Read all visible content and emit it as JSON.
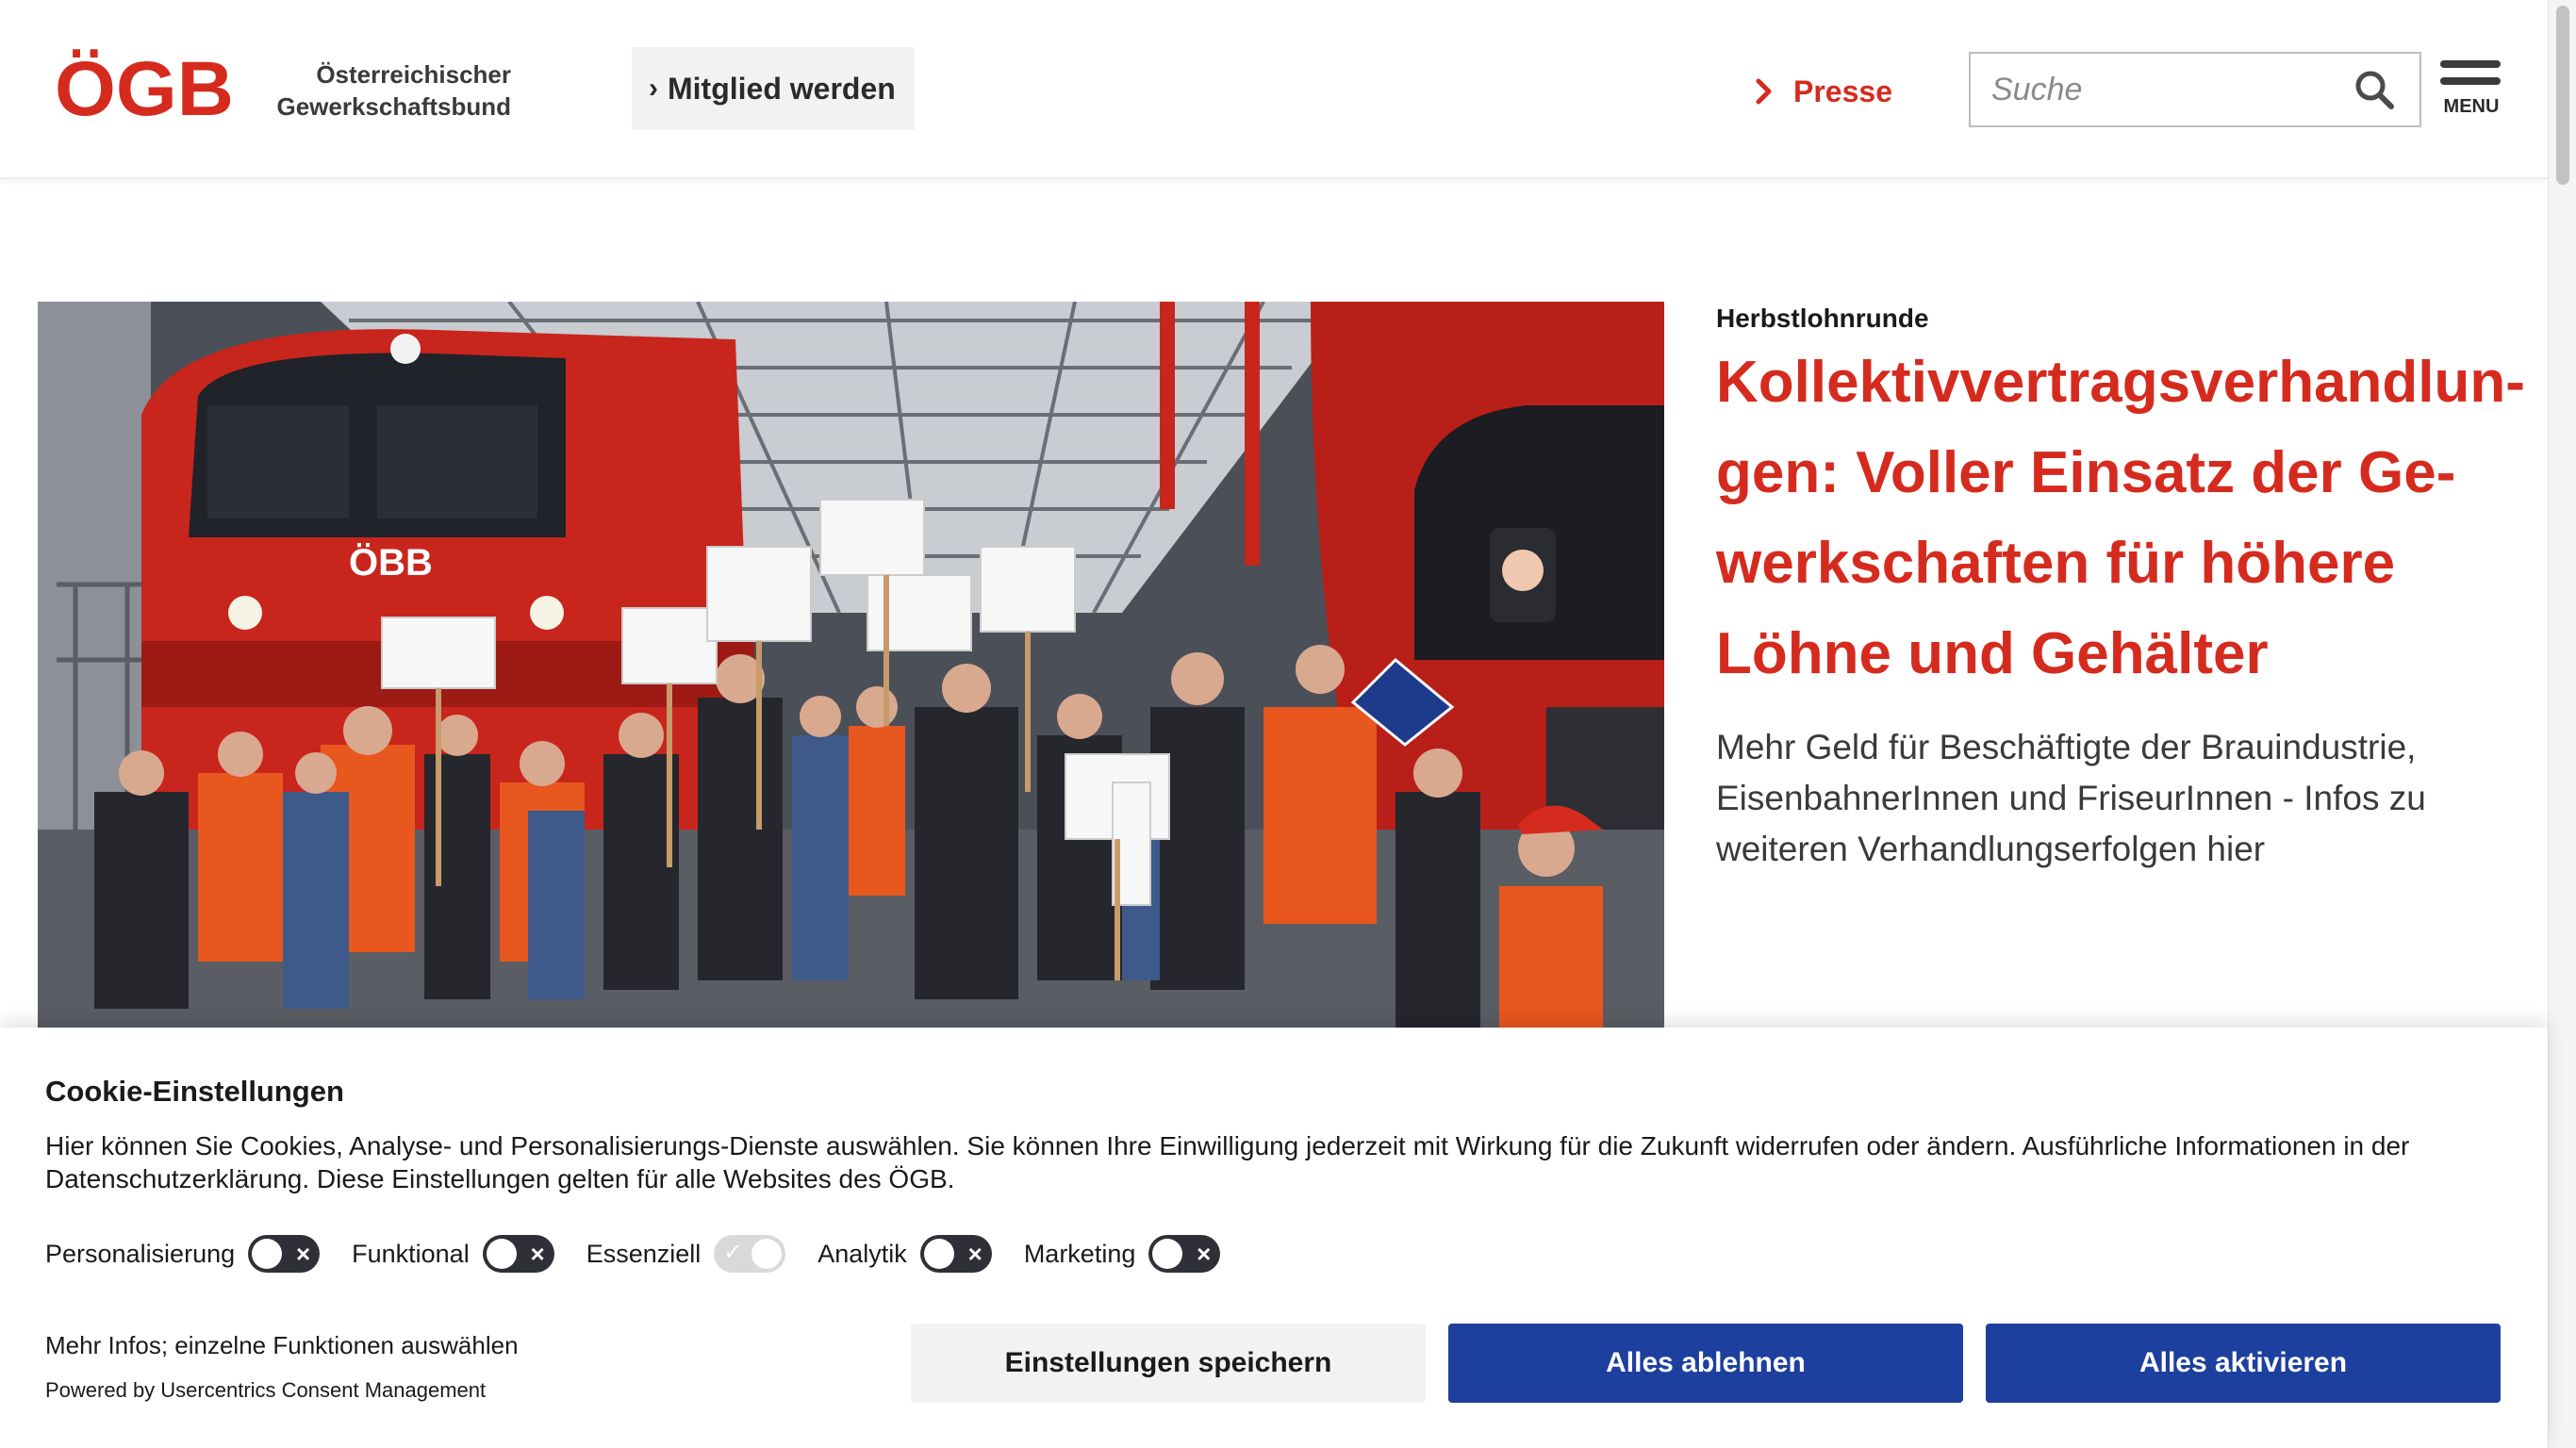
{
  "header": {
    "logo_text": "ÖGB",
    "org_name_line1": "Österreichischer",
    "org_name_line2": "Gewerkschaftsbund",
    "member_button": "Mitglied werden",
    "presse_link": "Presse",
    "search_placeholder": "Suche",
    "menu_label": "MENU"
  },
  "colors": {
    "brand_red": "#d52b1e",
    "button_blue": "#1d3f9e"
  },
  "hero": {
    "image_description": "ÖBB",
    "kicker": "Herbstlohnrunde",
    "headline": "Kollektivvertragsverhandlun­gen: Voller Einsatz der Ge­werkschaften für höhere Löh­ne und Gehälter",
    "teaser": "Mehr Geld für Beschäftigte der Brauindustrie, Eisen­bahnerInnen und FriseurInnen - Infos zu weiteren Verhandlungserfolgen hier"
  },
  "cookie": {
    "title": "Cookie-Einstellungen",
    "description": "Hier können Sie Cookies, Analyse- und Personalisierungs-Dienste auswählen. Sie können Ihre Einwilligung jederzeit mit Wirkung für die Zukunft widerrufen oder ändern. Ausführliche Informationen in der Datenschutzerklärung. Diese Einstellungen gelten für alle Websites des ÖGB.",
    "toggles": [
      {
        "label": "Personalisierung",
        "state": "off"
      },
      {
        "label": "Funktional",
        "state": "off"
      },
      {
        "label": "Essenziell",
        "state": "on-disabled"
      },
      {
        "label": "Analytik",
        "state": "off"
      },
      {
        "label": "Marketing",
        "state": "off"
      }
    ],
    "more_info": "Mehr Infos; einzelne Funktionen auswählen",
    "powered_by": "Powered by Usercentrics Consent Management",
    "save_button": "Einstellungen speichern",
    "deny_button": "Alles ablehnen",
    "accept_button": "Alles aktivieren"
  }
}
